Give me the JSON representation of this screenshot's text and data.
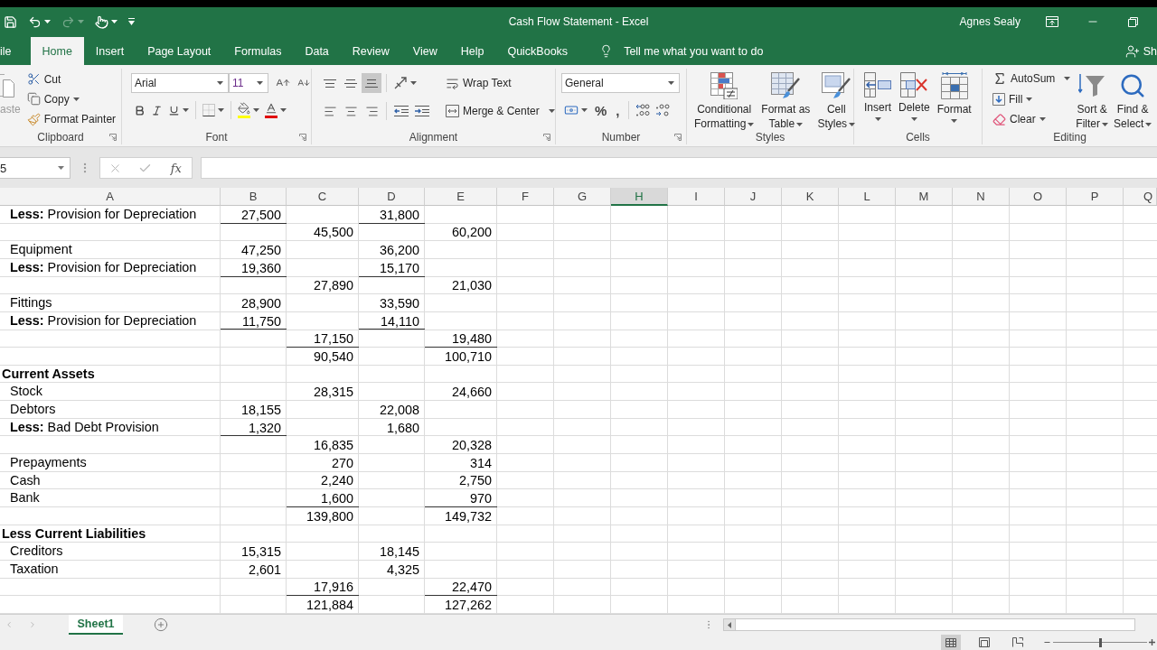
{
  "title_bar": {
    "title": "Cash Flow Statement  -  Excel",
    "user": "Agnes Sealy"
  },
  "quick_access": [
    {
      "kind": "save",
      "disabled": false
    },
    {
      "kind": "undo",
      "disabled": false
    },
    {
      "kind": "redo",
      "disabled": true
    },
    {
      "kind": "touch",
      "disabled": false
    }
  ],
  "ribbon_tabs": [
    {
      "label": "ile",
      "selected": false
    },
    {
      "label": "Home",
      "selected": true
    },
    {
      "label": "Insert",
      "selected": false
    },
    {
      "label": "Page Layout",
      "selected": false
    },
    {
      "label": "Formulas",
      "selected": false
    },
    {
      "label": "Data",
      "selected": false
    },
    {
      "label": "Review",
      "selected": false
    },
    {
      "label": "View",
      "selected": false
    },
    {
      "label": "Help",
      "selected": false
    },
    {
      "label": "QuickBooks",
      "selected": false
    }
  ],
  "tell_me": {
    "placeholder": "Tell me what you want to do"
  },
  "share": {
    "label": "Sh"
  },
  "ribbon": {
    "clipboard": {
      "label": "Clipboard",
      "paste": {
        "label": "aste",
        "disabled": true
      },
      "cut": "Cut",
      "copy": "Copy",
      "format_painter": "Format Painter"
    },
    "font": {
      "label": "Font",
      "font_name": "Arial",
      "font_size": "11"
    },
    "alignment": {
      "label": "Alignment",
      "vertical_align": [
        {
          "kind": "top",
          "selected": false
        },
        {
          "kind": "middle",
          "selected": false
        },
        {
          "kind": "bottom",
          "selected": true
        }
      ],
      "wrap_text": "Wrap Text",
      "merge_center": "Merge & Center"
    },
    "number": {
      "label": "Number",
      "format": "General",
      "percent": "%",
      "comma": ","
    },
    "styles": {
      "label": "Styles",
      "buttons": [
        {
          "kind": "conditional",
          "lines": [
            "Conditional",
            "Formatting"
          ]
        },
        {
          "kind": "table",
          "lines": [
            "Format as",
            "Table"
          ]
        },
        {
          "kind": "cell_styles",
          "lines": [
            "Cell",
            "Styles"
          ]
        }
      ]
    },
    "cells": {
      "label": "Cells",
      "buttons": [
        {
          "kind": "insert",
          "label": "Insert"
        },
        {
          "kind": "delete",
          "label": "Delete"
        },
        {
          "kind": "format",
          "label": "Format"
        }
      ]
    },
    "editing": {
      "label": "Editing",
      "autosum": "AutoSum",
      "fill": "Fill",
      "clear": "Clear",
      "sort_filter": [
        "Sort &",
        "Filter"
      ],
      "find_select": [
        "Find &",
        "Select"
      ]
    }
  },
  "formula_bar": {
    "name_box": "5",
    "entry_buttons_enabled": false,
    "function_label": "fx"
  },
  "columns": [
    {
      "label": "A",
      "selected": false
    },
    {
      "label": "B",
      "selected": false
    },
    {
      "label": "C",
      "selected": false
    },
    {
      "label": "D",
      "selected": false
    },
    {
      "label": "E",
      "selected": false
    },
    {
      "label": "F",
      "selected": false
    },
    {
      "label": "G",
      "selected": false
    },
    {
      "label": "H",
      "selected": true
    },
    {
      "label": "I",
      "selected": false
    },
    {
      "label": "J",
      "selected": false
    },
    {
      "label": "K",
      "selected": false
    },
    {
      "label": "L",
      "selected": false
    },
    {
      "label": "M",
      "selected": false
    },
    {
      "label": "N",
      "selected": false
    },
    {
      "label": "O",
      "selected": false
    },
    {
      "label": "P",
      "selected": false
    },
    {
      "label": "Q",
      "selected": false
    }
  ],
  "rows": [
    {
      "label": {
        "text": "**Less:** Provision for Depreciation",
        "heading": false
      },
      "b": {
        "value": "27,500",
        "ruled": true
      },
      "d": {
        "value": "31,800",
        "ruled": true
      }
    },
    {
      "c": {
        "value": "45,500",
        "ruled": false
      },
      "e": {
        "value": "60,200",
        "ruled": false
      }
    },
    {
      "label": {
        "text": "Equipment",
        "heading": false
      },
      "b": {
        "value": "47,250",
        "ruled": false
      },
      "d": {
        "value": "36,200",
        "ruled": false
      }
    },
    {
      "label": {
        "text": "**Less:** Provision for Depreciation",
        "heading": false
      },
      "b": {
        "value": "19,360",
        "ruled": true
      },
      "d": {
        "value": "15,170",
        "ruled": true
      }
    },
    {
      "c": {
        "value": "27,890",
        "ruled": false
      },
      "e": {
        "value": "21,030",
        "ruled": false
      }
    },
    {
      "label": {
        "text": "Fittings",
        "heading": false
      },
      "b": {
        "value": "28,900",
        "ruled": false
      },
      "d": {
        "value": "33,590",
        "ruled": false
      }
    },
    {
      "label": {
        "text": "**Less:** Provision for Depreciation",
        "heading": false
      },
      "b": {
        "value": "11,750",
        "ruled": true
      },
      "d": {
        "value": "14,110",
        "ruled": true
      }
    },
    {
      "c": {
        "value": "17,150",
        "ruled": true
      },
      "e": {
        "value": "19,480",
        "ruled": true
      }
    },
    {
      "c": {
        "value": "90,540",
        "ruled": false
      },
      "e": {
        "value": "100,710",
        "ruled": false
      }
    },
    {
      "label": {
        "text": "Current Assets",
        "heading": true
      }
    },
    {
      "label": {
        "text": "Stock",
        "heading": false
      },
      "c": {
        "value": "28,315",
        "ruled": false
      },
      "e": {
        "value": "24,660",
        "ruled": false
      }
    },
    {
      "label": {
        "text": "Debtors",
        "heading": false
      },
      "b": {
        "value": "18,155",
        "ruled": false
      },
      "d": {
        "value": "22,008",
        "ruled": false
      }
    },
    {
      "label": {
        "text": "**Less:** Bad Debt Provision",
        "heading": false
      },
      "b": {
        "value": "1,320",
        "ruled": true
      },
      "d": {
        "value": "1,680",
        "ruled": false
      }
    },
    {
      "c": {
        "value": "16,835",
        "ruled": false
      },
      "e": {
        "value": "20,328",
        "ruled": false
      }
    },
    {
      "label": {
        "text": "Prepayments",
        "heading": false
      },
      "c": {
        "value": "270",
        "ruled": false
      },
      "e": {
        "value": "314",
        "ruled": false
      }
    },
    {
      "label": {
        "text": "Cash",
        "heading": false
      },
      "c": {
        "value": "2,240",
        "ruled": false
      },
      "e": {
        "value": "2,750",
        "ruled": false
      }
    },
    {
      "label": {
        "text": "Bank",
        "heading": false
      },
      "c": {
        "value": "1,600",
        "ruled": true
      },
      "e": {
        "value": "970",
        "ruled": true
      }
    },
    {
      "c": {
        "value": "139,800",
        "ruled": false
      },
      "e": {
        "value": "149,732",
        "ruled": false
      }
    },
    {
      "label": {
        "text": "Less Current Liabilities",
        "heading": true
      }
    },
    {
      "label": {
        "text": "Creditors",
        "heading": false
      },
      "b": {
        "value": "15,315",
        "ruled": false
      },
      "d": {
        "value": "18,145",
        "ruled": false
      }
    },
    {
      "label": {
        "text": "Taxation",
        "heading": false
      },
      "b": {
        "value": "2,601",
        "ruled": false
      },
      "d": {
        "value": "4,325",
        "ruled": false
      }
    },
    {
      "c": {
        "value": "17,916",
        "ruled": true
      },
      "e": {
        "value": "22,470",
        "ruled": true
      }
    },
    {
      "c": {
        "value": "121,884",
        "ruled": false
      },
      "e": {
        "value": "127,262",
        "ruled": false
      }
    }
  ],
  "sheet_tabs": [
    {
      "label": "Sheet1",
      "selected": true
    }
  ],
  "status_bar": {
    "views": [
      {
        "kind": "normal",
        "selected": true
      },
      {
        "kind": "page_layout",
        "selected": false
      },
      {
        "kind": "page_break",
        "selected": false
      }
    ],
    "zoom": {
      "level": 0.5
    }
  }
}
